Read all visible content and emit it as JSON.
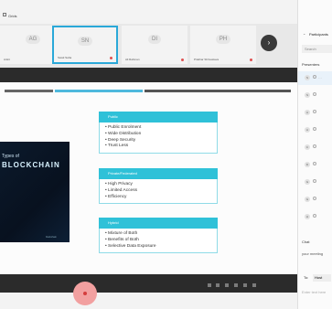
{
  "meeting": {
    "topbar_label": "Grids",
    "participants_strip": [
      {
        "initials": "AG",
        "name": "Ankit",
        "active": false
      },
      {
        "initials": "SN",
        "name": "Swati Saha",
        "active": true
      },
      {
        "initials": "DI",
        "name": "Ali Rahman",
        "active": false
      },
      {
        "initials": "PH",
        "name": "Prakhar Shrivastava",
        "active": false
      }
    ],
    "next_icon": "chevron-right-icon"
  },
  "slide": {
    "cover_title_small": "Types of",
    "cover_title_big": "BLOCKCHAIN",
    "cover_credit": "blockchain",
    "groups": [
      {
        "title": "Public",
        "items": [
          "Public Enrolment",
          "Wide Distribution",
          "Deep Security",
          "Trust Less"
        ]
      },
      {
        "title": "Private/Federated",
        "items": [
          "High Privacy",
          "Limited Access",
          "Efficiency"
        ]
      },
      {
        "title": "Hybrid",
        "items": [
          "Mixture of Both",
          "Benefits of Both",
          "Selective Data Exposure"
        ]
      }
    ]
  },
  "sidebar": {
    "title": "Participants",
    "search_placeholder": "Search",
    "section": "Presenters",
    "rows": [
      "S",
      "S",
      "A",
      "A",
      "C",
      "D",
      "G",
      "G",
      "H"
    ],
    "chat_title": "Chat",
    "chat_note": "your meeting",
    "to_label": "To:",
    "to_value": "Host",
    "input_hint": "Enter text here"
  }
}
